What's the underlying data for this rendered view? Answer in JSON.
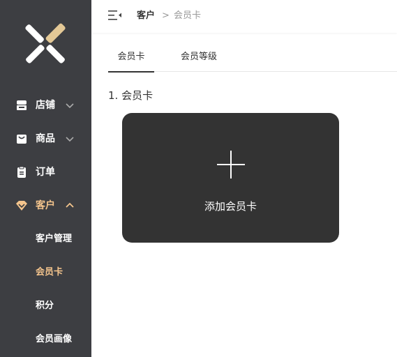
{
  "sidebar": {
    "logo_icon": "x-logo-icon",
    "items": [
      {
        "label": "店铺",
        "icon": "store-icon",
        "expandable": true
      },
      {
        "label": "商品",
        "icon": "bag-icon",
        "expandable": true
      },
      {
        "label": "订单",
        "icon": "clipboard-icon",
        "expandable": false
      },
      {
        "label": "客户",
        "icon": "diamond-icon",
        "expandable": true,
        "expanded": true
      }
    ],
    "sub_items": [
      {
        "label": "客户管理"
      },
      {
        "label": "会员卡"
      },
      {
        "label": "积分"
      },
      {
        "label": "会员画像"
      }
    ],
    "active_color": "#f5c58d",
    "background": "#3d3e42"
  },
  "breadcrumb": {
    "parent": "客户",
    "separator": ">",
    "current": "会员卡"
  },
  "tabs": [
    {
      "label": "会员卡"
    },
    {
      "label": "会员等级"
    }
  ],
  "section": {
    "title": "1. 会员卡"
  },
  "add_card": {
    "label": "添加会员卡",
    "icon": "plus-icon",
    "background": "#333333"
  }
}
